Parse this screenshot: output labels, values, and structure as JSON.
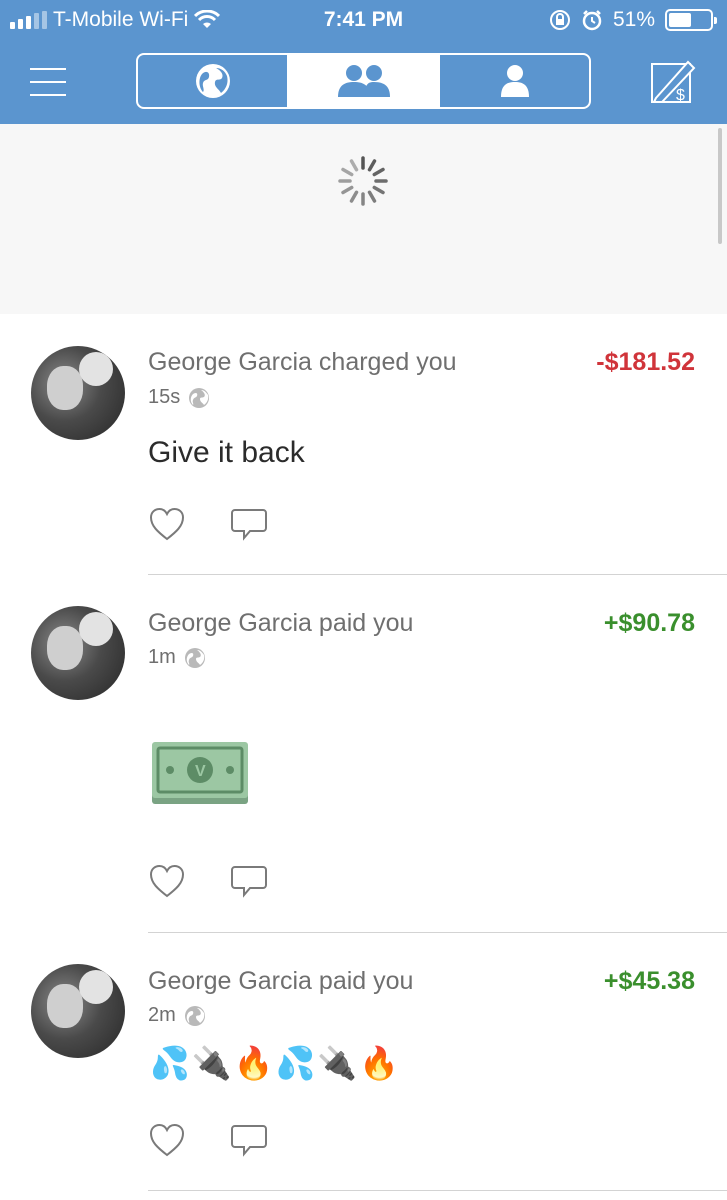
{
  "status_bar": {
    "carrier": "T-Mobile Wi-Fi",
    "time": "7:41 PM",
    "battery": "51%"
  },
  "nav": {
    "tabs": [
      "globe-icon",
      "friends-icon",
      "person-icon"
    ],
    "active_tab": 1
  },
  "feed": [
    {
      "title": "George Garcia charged you",
      "amount": "-$181.52",
      "time": "15s",
      "note": "Give it back"
    },
    {
      "title": "George Garcia paid you",
      "amount": "+$90.78",
      "time": "1m",
      "note_emoji": "money-bill-emoji"
    },
    {
      "title": "George Garcia paid you",
      "amount": "+$45.38",
      "time": "2m",
      "note": "💦🔌🔥💦🔌🔥"
    }
  ]
}
